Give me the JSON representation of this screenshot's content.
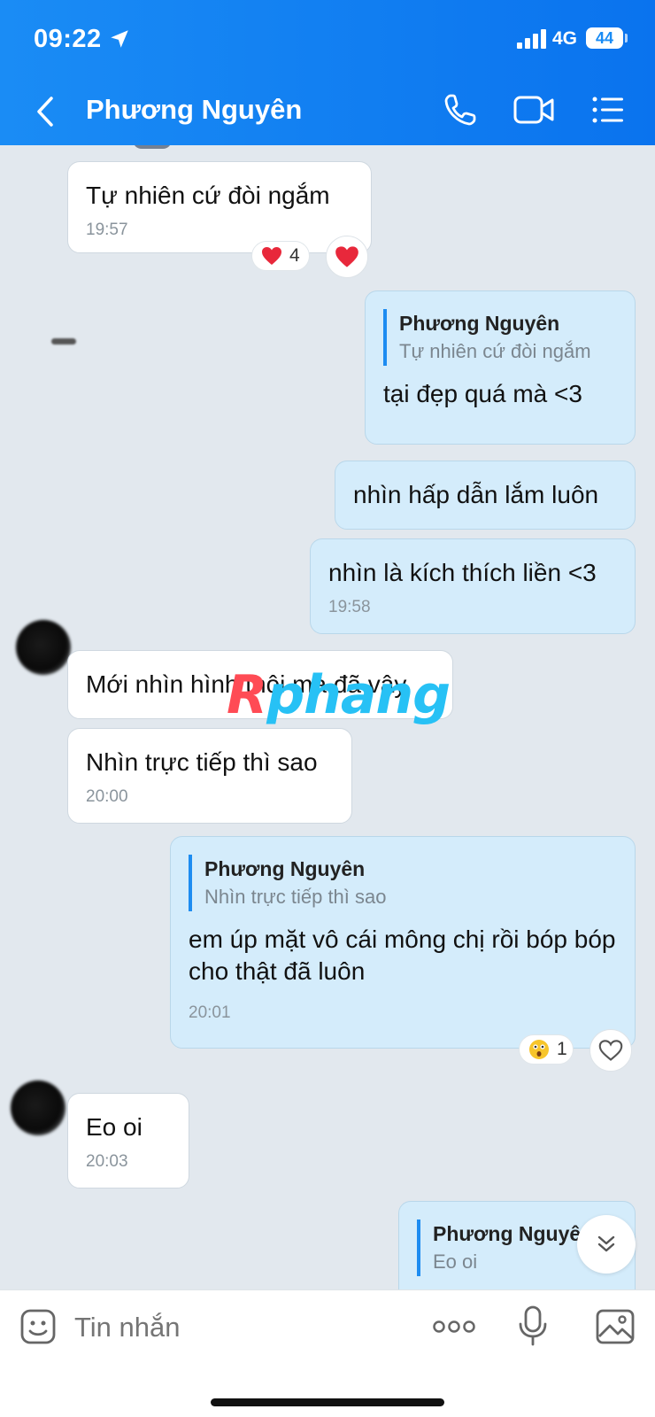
{
  "status_bar": {
    "time": "09:22",
    "network": "4G",
    "battery": "44"
  },
  "header": {
    "contact_name": "Phương Nguyên"
  },
  "messages": [
    {
      "direction": "in",
      "text": "Tự nhiên cứ đòi ngắm",
      "time": "19:57",
      "reaction_count": "4",
      "reaction_emoji": "red-heart"
    },
    {
      "direction": "out",
      "quote_name": "Phương Nguyên",
      "quote_text": "Tự nhiên cứ đòi ngắm",
      "text": "tại đẹp quá mà <3"
    },
    {
      "direction": "out",
      "text": "nhìn hấp dẫn lắm luôn"
    },
    {
      "direction": "out",
      "text": "nhìn là kích thích liền <3",
      "time": "19:58"
    },
    {
      "direction": "in",
      "text": "Mới nhìn hình thôi mà đã vậy"
    },
    {
      "direction": "in",
      "text": "Nhìn trực tiếp thì sao",
      "time": "20:00"
    },
    {
      "direction": "out",
      "quote_name": "Phương Nguyên",
      "quote_text": "Nhìn trực tiếp thì sao",
      "text": "em úp mặt vô  cái mông chị rồi bóp bóp cho thật đã luôn",
      "time": "20:01",
      "reaction_count": "1",
      "reaction_emoji": "surprised-face"
    },
    {
      "direction": "in",
      "text": "Eo oi",
      "time": "20:03"
    },
    {
      "direction": "out",
      "quote_name": "Phương Nguyê",
      "quote_text": "Eo oi"
    }
  ],
  "watermark": {
    "first": "R",
    "rest": "phang"
  },
  "composer": {
    "placeholder": "Tin nhắn"
  },
  "colors": {
    "header": "#0a73ee",
    "outgoing_bubble": "#d4ecfb",
    "incoming_bubble": "#ffffff",
    "background": "#e2e8ee",
    "quote_bar": "#1d8cf1"
  }
}
